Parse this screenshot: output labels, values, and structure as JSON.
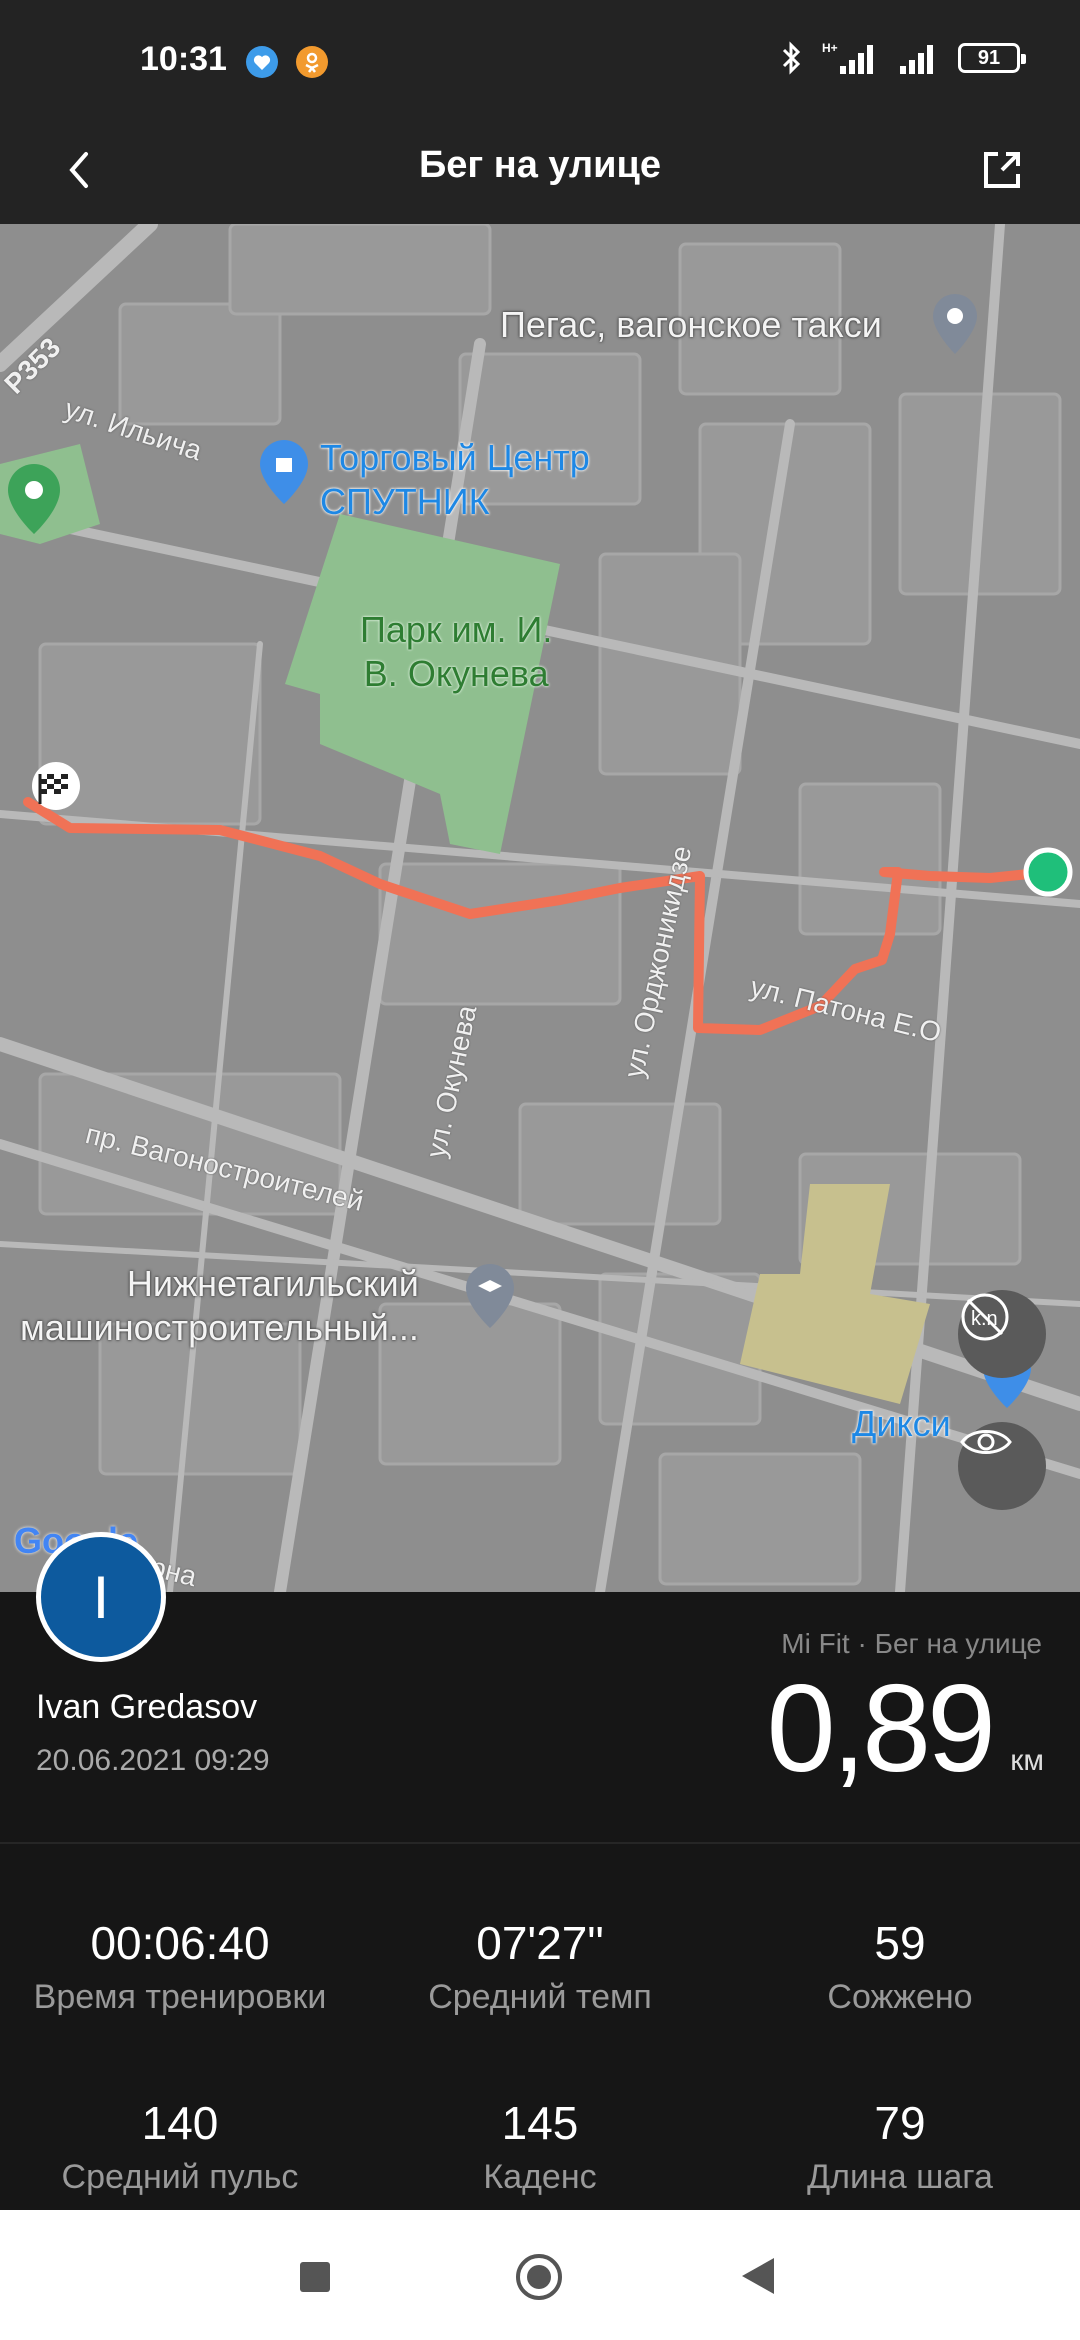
{
  "status_bar": {
    "time": "10:31",
    "battery": "91",
    "icons": [
      "heart-app-icon",
      "ok-app-icon",
      "bluetooth-icon",
      "signal-icon",
      "signal-icon",
      "battery-icon"
    ]
  },
  "app_bar": {
    "title": "Бег на улице"
  },
  "map": {
    "labels": {
      "road": "Р353",
      "street_ilyicha": "ул. Ильича",
      "taxi": "Пегас, вагонское такси",
      "mall_line1": "Торговый Центр",
      "mall_line2": "СПУТНИК",
      "park_line1": "Парк им. И.",
      "park_line2": "В. Окунева",
      "street_ordzhonikidze": "ул. Орджоникидзе",
      "street_patona": "ул. Патона Е.О",
      "street_okuneva": "ул. Окунева",
      "street_vagonostroitelei": "пр. Вагоностроителей",
      "college_line1": "Нижнетагильский",
      "college_line2": "машиностроительный...",
      "shop": "Дикси",
      "street_partial": "рна",
      "google": "Google"
    },
    "route_color": "#f07256",
    "start_color": "#1fbf7a"
  },
  "workout": {
    "user_initial": "I",
    "user_name": "Ivan Gredasov",
    "datetime": "20.06.2021 09:29",
    "source": "Mi Fit · Бег на улице",
    "distance": "0,89",
    "unit": "км"
  },
  "stats": [
    {
      "value": "00:06:40",
      "label": "Время тренировки"
    },
    {
      "value": "07'27\"",
      "label": "Средний темп"
    },
    {
      "value": "59",
      "label": "Сожжено"
    },
    {
      "value": "140",
      "label": "Средний пульс"
    },
    {
      "value": "145",
      "label": "Каденс"
    },
    {
      "value": "79",
      "label": "Длина шага"
    }
  ]
}
